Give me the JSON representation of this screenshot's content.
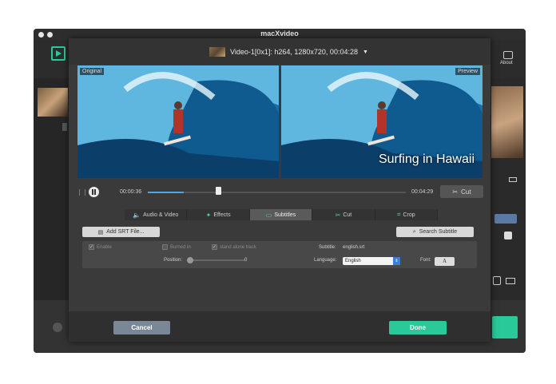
{
  "window": {
    "title": "macXvideo"
  },
  "background_app": {
    "about_label": "About",
    "green_accent": "#29c99a"
  },
  "modal": {
    "video_selector": "Video-1[0x1]: h264, 1280x720, 00:04:28",
    "preview_left_label": "Original",
    "preview_right_label": "Preview",
    "subtitle_overlay": "Surfing in Hawaii",
    "playback": {
      "current_time": "00:00:36",
      "total_time": "00:04:29",
      "progress": 0.14,
      "cut_label": "Cut"
    },
    "tabs": [
      {
        "label": "Audio & Video",
        "icon": "speaker-icon",
        "active": false
      },
      {
        "label": "Effects",
        "icon": "wand-icon",
        "active": false
      },
      {
        "label": "Subtitles",
        "icon": "subtitles-icon",
        "active": true
      },
      {
        "label": "Cut",
        "icon": "scissors-icon",
        "active": false
      },
      {
        "label": "Crop",
        "icon": "crop-icon",
        "active": false
      }
    ],
    "subtitles": {
      "add_srt_label": "Add SRT File...",
      "search_label": "Search Subtitle",
      "enable_label": "Enable",
      "burned_in_label": "Burned in",
      "stand_alone_label": "stand alone track",
      "subtitle_label": "Subtitle:",
      "subtitle_value": "english.srt",
      "position_label": "Position:",
      "position_value": "0",
      "language_label": "Language:",
      "language_value": "English",
      "font_label": "Font:",
      "font_button": "A"
    },
    "footer": {
      "cancel_label": "Cancel",
      "done_label": "Done"
    }
  }
}
